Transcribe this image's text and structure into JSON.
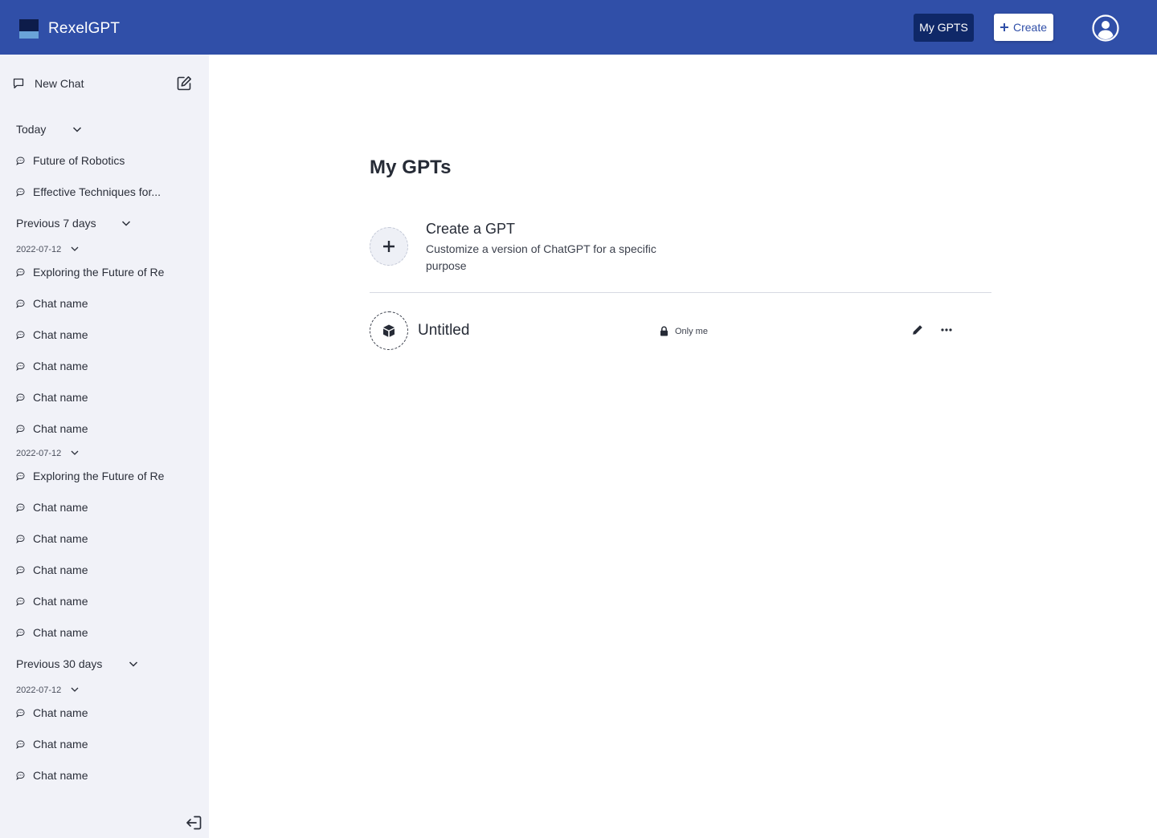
{
  "header": {
    "app_title": "RexelGPT",
    "my_gpts_label": "My GPTS",
    "create_label": "Create",
    "brand_color": "#304fa8",
    "accent_color": "#0f2868",
    "logo_icon": "rexel-logo",
    "profile_icon": "user-circle-icon"
  },
  "sidebar": {
    "new_chat_label": "New Chat",
    "sections": [
      {
        "label": "Today",
        "items": [
          "Future of Robotics",
          "Effective Techniques for..."
        ]
      },
      {
        "label": "Previous 7 days",
        "groups": [
          {
            "date": "2022-07-12",
            "items": [
              "Exploring the Future of Re",
              "Chat name",
              "Chat name",
              "Chat name",
              "Chat name",
              "Chat name"
            ]
          },
          {
            "date": "2022-07-12",
            "items": [
              "Exploring the Future of Re",
              "Chat name",
              "Chat name",
              "Chat name",
              "Chat name",
              "Chat name"
            ]
          }
        ]
      },
      {
        "label": "Previous 30 days",
        "groups": [
          {
            "date": "2022-07-12",
            "items": [
              "Chat name",
              "Chat name",
              "Chat name"
            ]
          }
        ]
      }
    ]
  },
  "main": {
    "title": "My GPTs",
    "create_gpt": {
      "title": "Create a GPT",
      "description": "Customize a version of ChatGPT for a specific purpose"
    },
    "gpts": [
      {
        "name": "Untitled",
        "visibility": "Only me"
      }
    ]
  }
}
